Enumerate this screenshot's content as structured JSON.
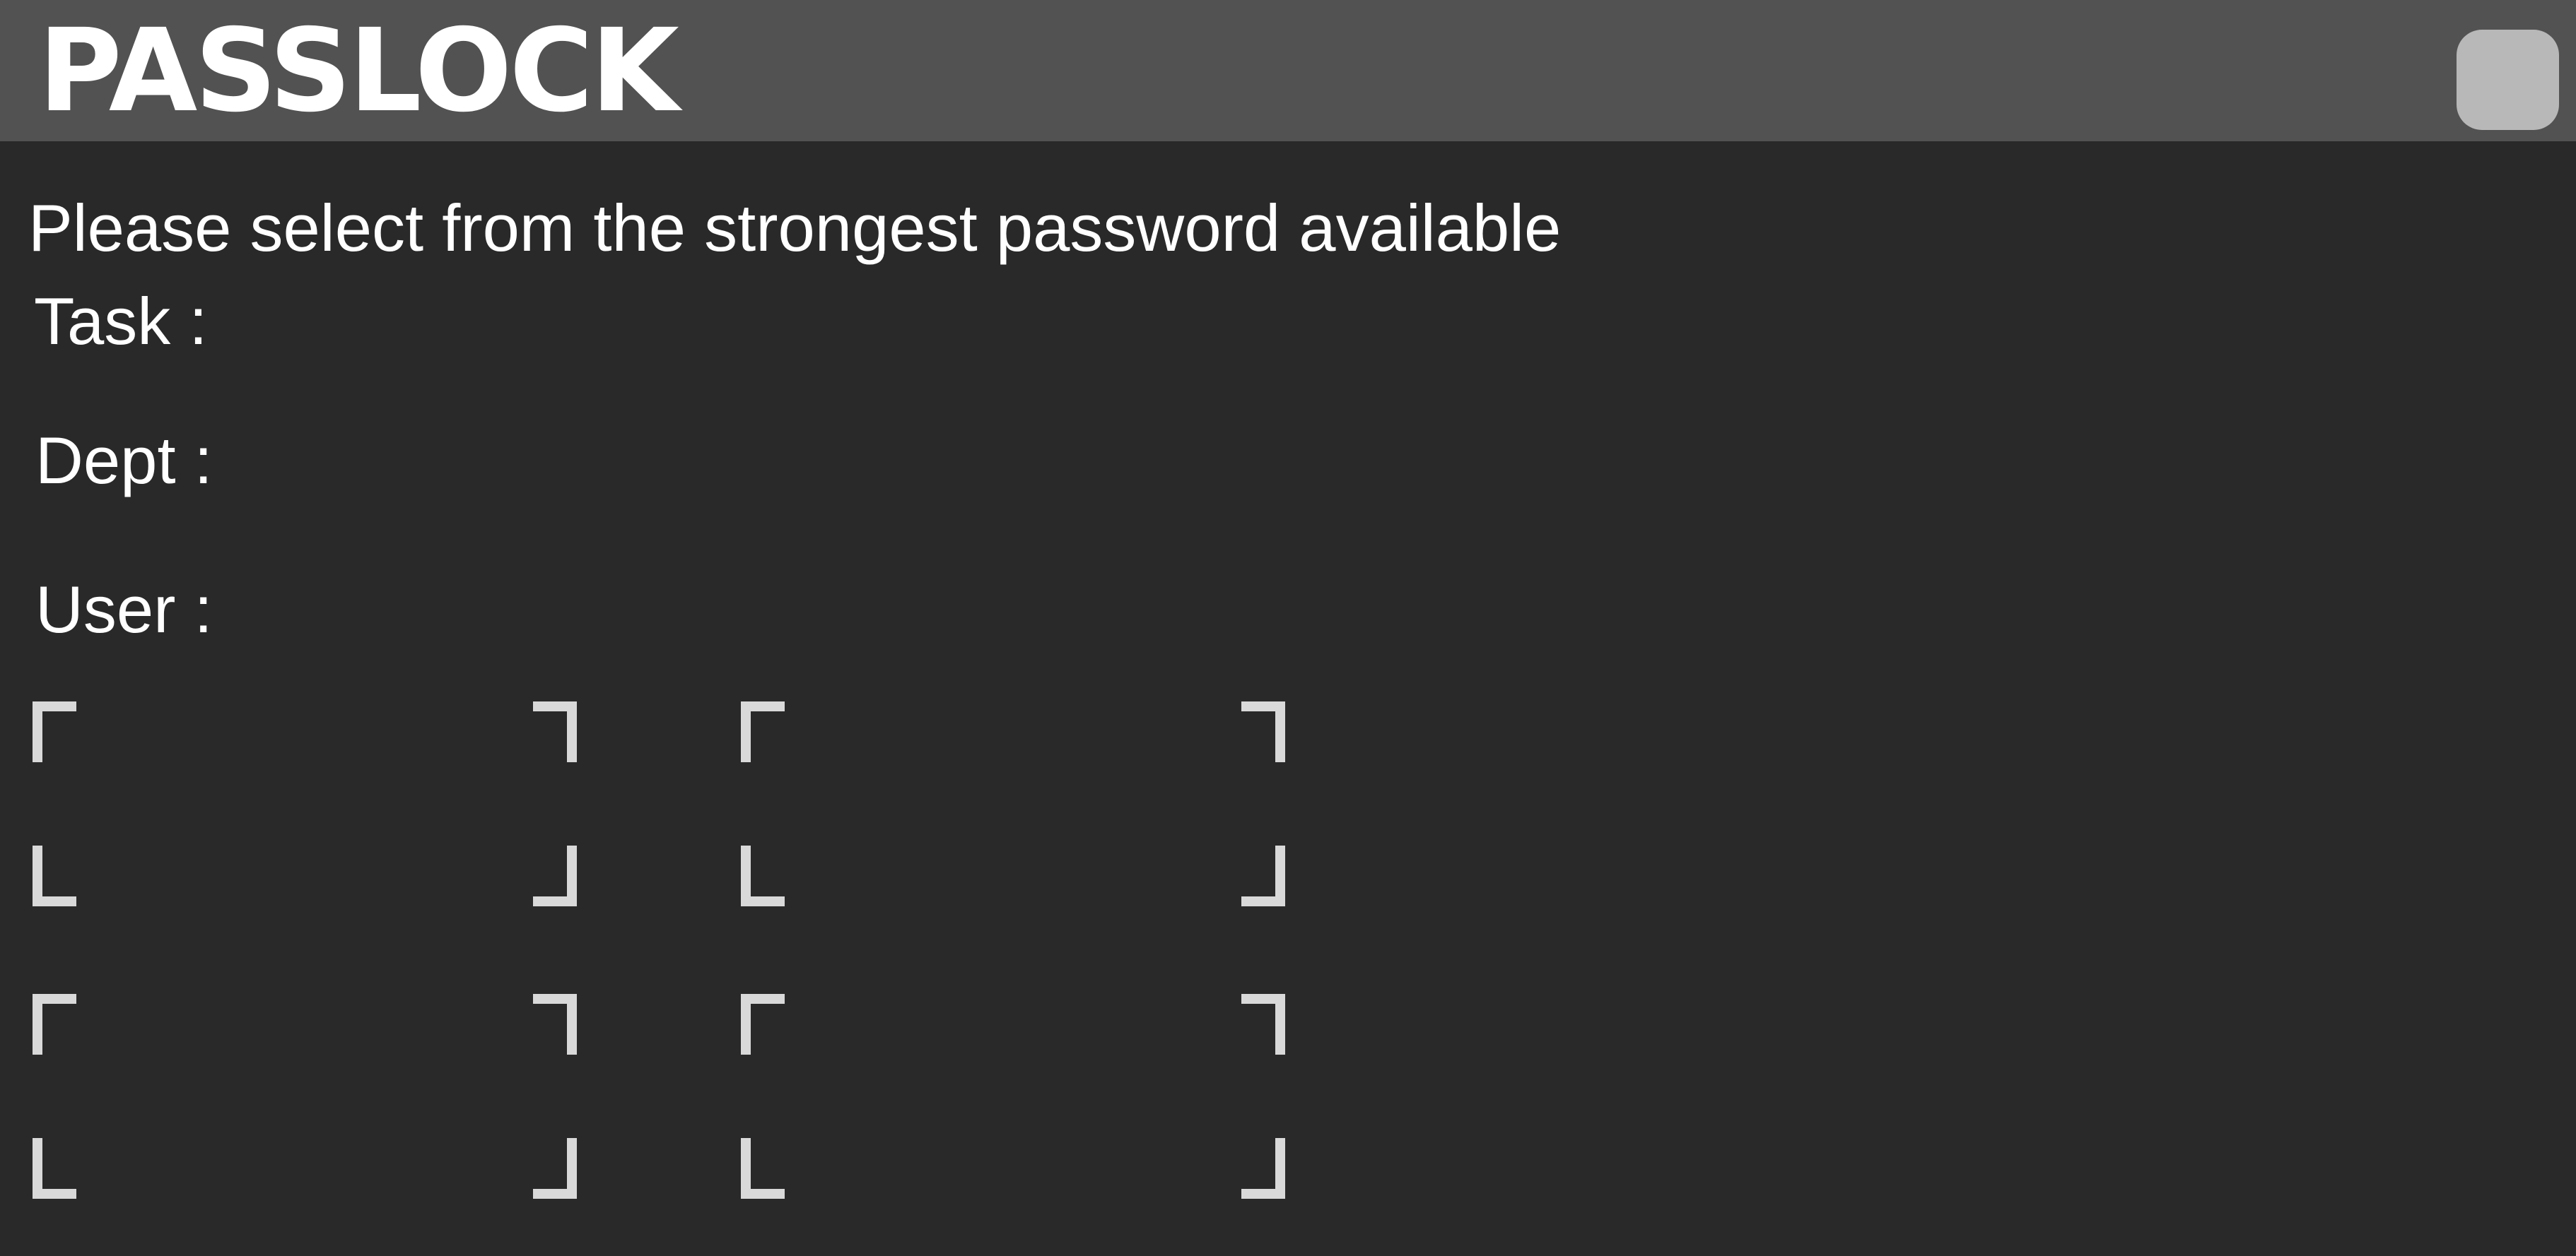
{
  "app": {
    "title": "PASSLOCK"
  },
  "prompt": {
    "instruction": "Please select from the strongest password available"
  },
  "fields": {
    "task_label": "Task :",
    "task_value": "",
    "dept_label": "Dept :",
    "dept_value": "",
    "user_label": "User :",
    "user_value": ""
  },
  "options": [
    {
      "text": ""
    },
    {
      "text": ""
    },
    {
      "text": ""
    },
    {
      "text": ""
    }
  ],
  "colors": {
    "background": "#292929",
    "header": "#525252",
    "menu_button": "#b8b8b8",
    "bracket": "#d9d9d9",
    "text": "#ffffff"
  }
}
